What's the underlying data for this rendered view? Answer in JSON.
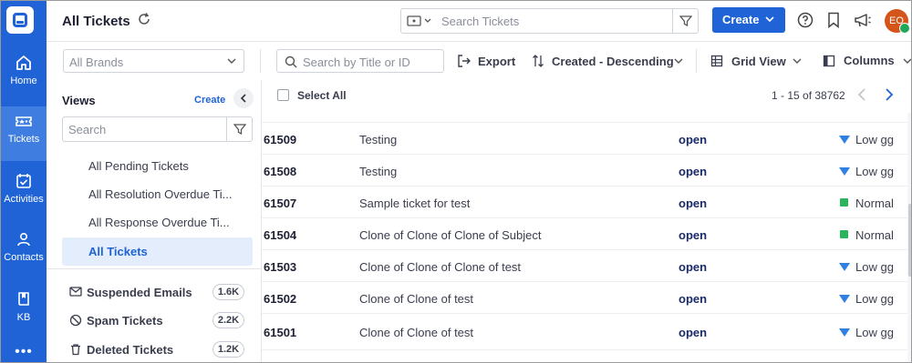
{
  "nav": {
    "items": [
      {
        "label": "Home",
        "icon": "home-icon"
      },
      {
        "label": "Tickets",
        "icon": "ticket-icon"
      },
      {
        "label": "Activities",
        "icon": "calendar-check-icon"
      },
      {
        "label": "Contacts",
        "icon": "person-icon"
      },
      {
        "label": "KB",
        "icon": "book-icon"
      }
    ],
    "more": "•••"
  },
  "header": {
    "title": "All Tickets",
    "search_placeholder": "Search Tickets",
    "create_label": "Create",
    "avatar_initials": "EO"
  },
  "toolbar": {
    "brand_placeholder": "All Brands",
    "search_placeholder": "Search by Title or ID",
    "export_label": "Export",
    "sort_label": "Created - Descending",
    "view_label": "Grid View",
    "columns_label": "Columns"
  },
  "views": {
    "title": "Views",
    "create_label": "Create",
    "search_placeholder": "Search",
    "items": [
      {
        "label": "All Pending Tickets"
      },
      {
        "label": "All Resolution Overdue Ti..."
      },
      {
        "label": "All Response Overdue Ti..."
      },
      {
        "label": "All Tickets"
      }
    ],
    "folders": [
      {
        "label": "Suspended Emails",
        "count": "1.6K",
        "icon": "mail-icon"
      },
      {
        "label": "Spam Tickets",
        "count": "2.2K",
        "icon": "block-icon"
      },
      {
        "label": "Deleted Tickets",
        "count": "1.2K",
        "icon": "trash-icon"
      }
    ]
  },
  "list": {
    "select_all": "Select All",
    "pagination": "1 - 15 of 38762",
    "rows": [
      {
        "id": "61509",
        "subject": "Testing",
        "status": "open",
        "priority": "Low gg",
        "priority_icon": "triangle-down"
      },
      {
        "id": "61508",
        "subject": "Testing",
        "status": "open",
        "priority": "Low gg",
        "priority_icon": "triangle-down"
      },
      {
        "id": "61507",
        "subject": "Sample ticket for test",
        "status": "open",
        "priority": "Normal",
        "priority_icon": "square"
      },
      {
        "id": "61504",
        "subject": "Clone of Clone of Clone of Subject",
        "status": "open",
        "priority": "Normal",
        "priority_icon": "square"
      },
      {
        "id": "61503",
        "subject": "Clone of Clone of Clone of test",
        "status": "open",
        "priority": "Low gg",
        "priority_icon": "triangle-down"
      },
      {
        "id": "61502",
        "subject": "Clone of Clone of test",
        "status": "open",
        "priority": "Low gg",
        "priority_icon": "triangle-down"
      },
      {
        "id": "61501",
        "subject": "Clone of Clone of test",
        "status": "open",
        "priority": "Low gg",
        "priority_icon": "triangle-down"
      }
    ]
  },
  "colors": {
    "brand": "#1f63d6",
    "status_open": "#1a2b6b",
    "priority_low": "#2f80e4",
    "priority_normal": "#2bb45a",
    "avatar": "#d4551a"
  }
}
